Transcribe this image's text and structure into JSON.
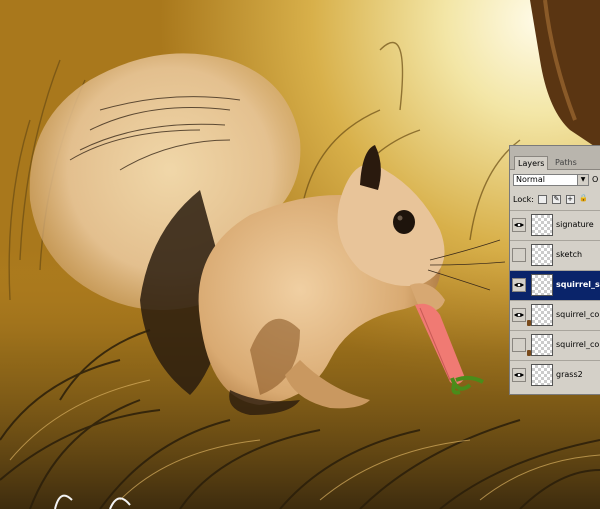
{
  "colors": {
    "panel_bg": "#d4d0c8",
    "selected_row": "#0a246a",
    "sky": "#f3e6a6",
    "grass": "#b57f1c",
    "fur": "#e0b98a",
    "carrot": "#f07a73"
  },
  "layers_panel": {
    "tabs": [
      {
        "label": "Layers",
        "active": true
      },
      {
        "label": "Paths",
        "active": false
      }
    ],
    "blend_mode": "Normal",
    "opacity_label": "O",
    "lock_label": "Lock:",
    "lock_icons": [
      "lock-transparent-icon",
      "lock-paint-icon",
      "lock-move-icon",
      "lock-all-icon"
    ],
    "layers": [
      {
        "name": "signature",
        "visible": true,
        "selected": false,
        "brush": false
      },
      {
        "name": "sketch",
        "visible": false,
        "selected": false,
        "brush": false
      },
      {
        "name": "squirrel_sketch",
        "visible": true,
        "selected": true,
        "brush": false
      },
      {
        "name": "squirrel_colour",
        "visible": true,
        "selected": false,
        "brush": true
      },
      {
        "name": "squirrel_colour",
        "visible": false,
        "selected": false,
        "brush": true
      },
      {
        "name": "grass2",
        "visible": true,
        "selected": false,
        "brush": false
      }
    ]
  }
}
